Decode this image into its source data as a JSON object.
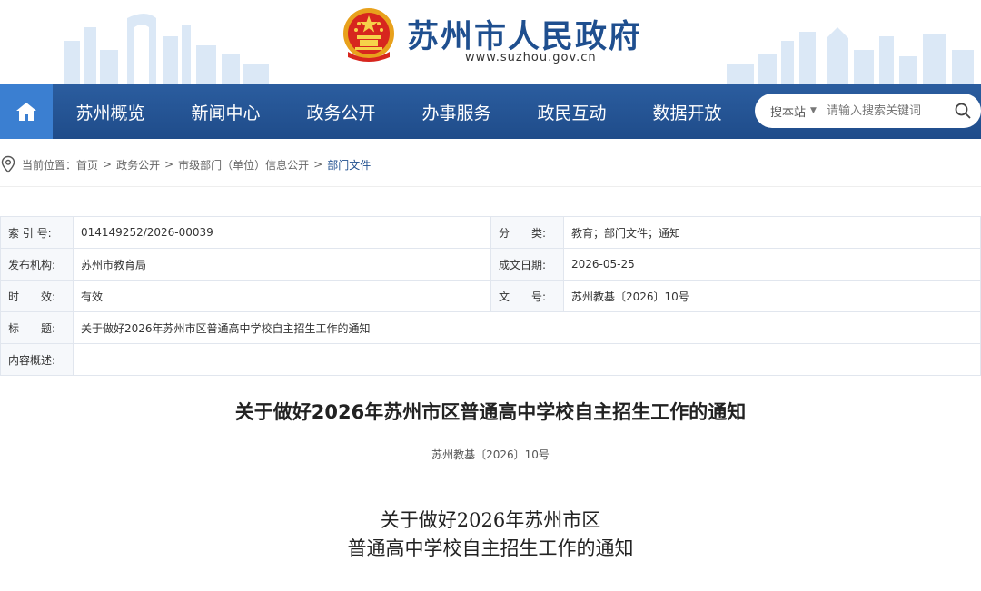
{
  "header": {
    "site_title": "苏州市人民政府",
    "site_url": "www.suzhou.gov.cn",
    "brand_color": "#1f4f8f"
  },
  "nav": {
    "home_icon": "home-icon",
    "items": [
      "苏州概览",
      "新闻中心",
      "政务公开",
      "办事服务",
      "政民互动",
      "数据开放"
    ],
    "search": {
      "scope": "搜本站",
      "placeholder": "请输入搜索关键词",
      "icon": "search-icon"
    },
    "bar_color": "#245493",
    "home_color": "#3b7fd1"
  },
  "breadcrumb": {
    "prefix": "当前位置：",
    "items": [
      "首页",
      "政务公开",
      "市级部门（单位）信息公开",
      "部门文件"
    ],
    "separator": ">"
  },
  "info": {
    "index_label": "索 引 号:",
    "index_value": "014149252/2026-00039",
    "category_label": "分　　类:",
    "category_value": "教育；部门文件；通知",
    "publisher_label": "发布机构:",
    "publisher_value": "苏州市教育局",
    "date_label": "成文日期:",
    "date_value": "2026-05-25",
    "validity_label": "时　　效:",
    "validity_value": "有效",
    "docno_label": "文　　号:",
    "docno_value": "苏州教基〔2026〕10号",
    "title_label": "标　　题:",
    "title_value": "关于做好2026年苏州市区普通高中学校自主招生工作的通知",
    "summary_label": "内容概述:",
    "summary_value": ""
  },
  "article": {
    "title": "关于做好2026年苏州市区普通高中学校自主招生工作的通知",
    "doc_number": "苏州教基〔2026〕10号",
    "body_title_line1": "关于做好2026年苏州市区",
    "body_title_line2": "普通高中学校自主招生工作的通知"
  }
}
